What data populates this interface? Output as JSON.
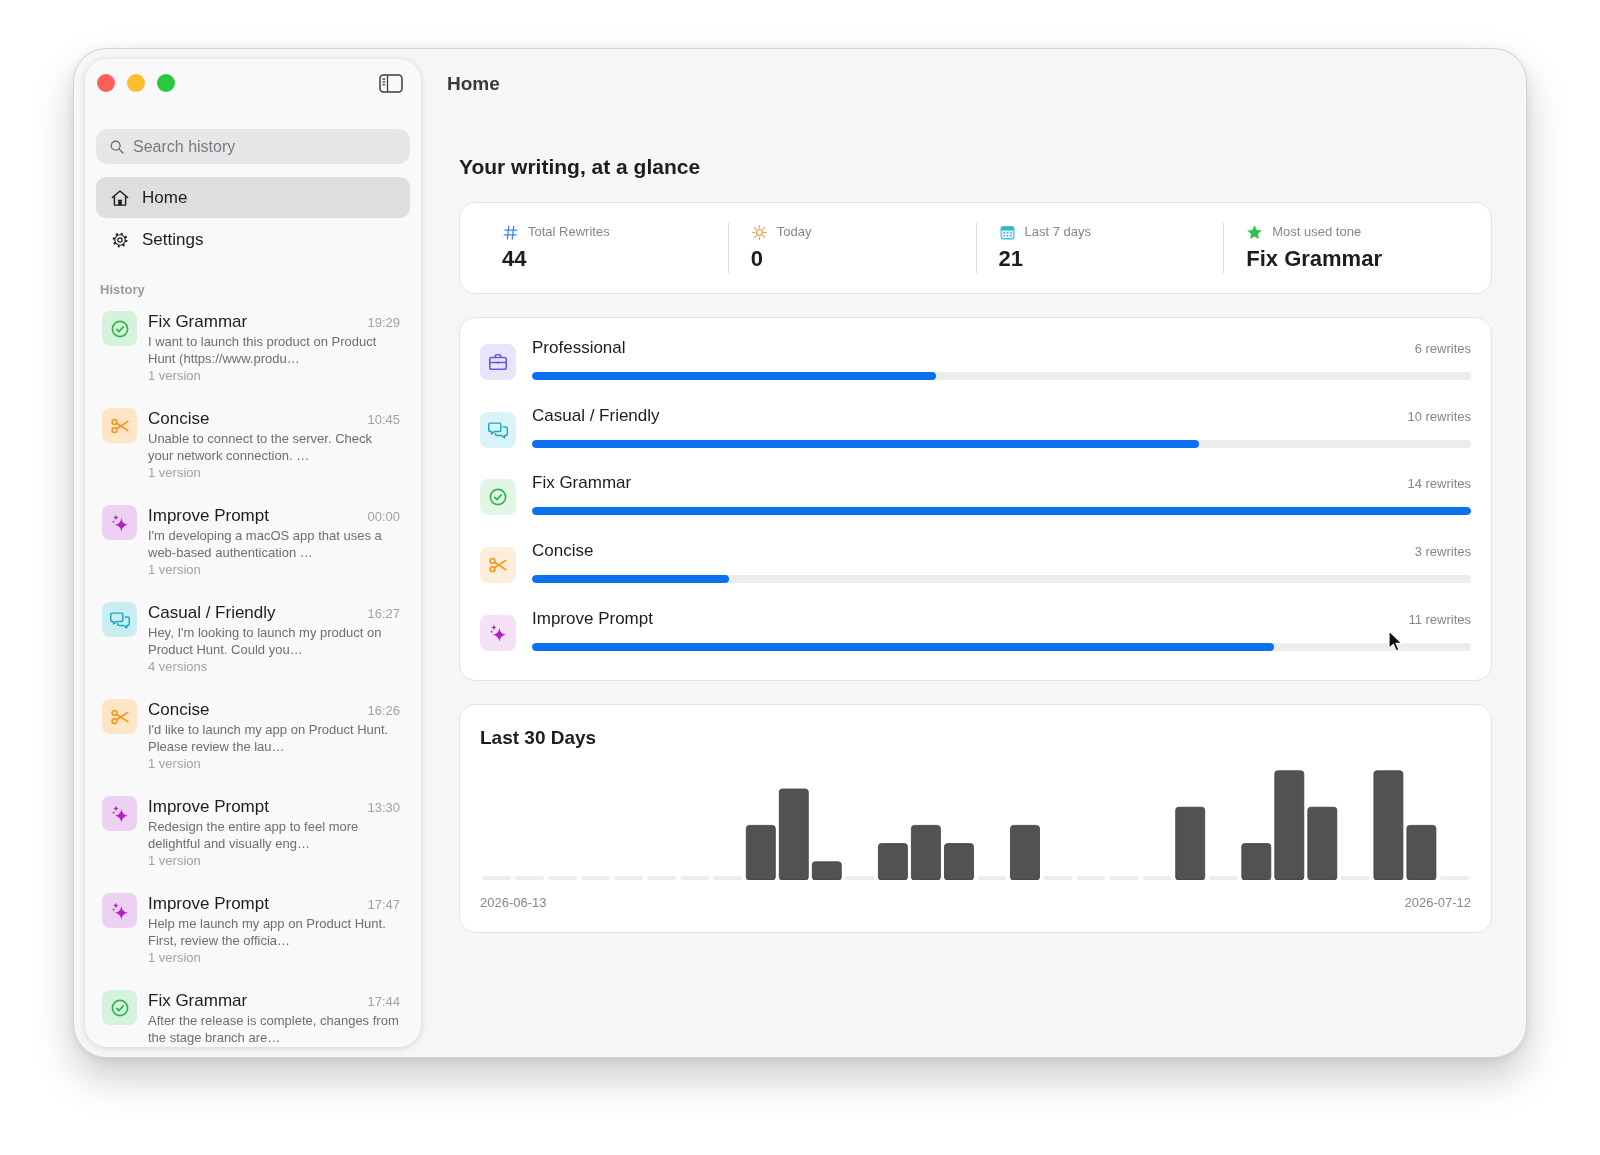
{
  "window": {
    "title": "Home"
  },
  "sidebar": {
    "search": {
      "placeholder": "Search history"
    },
    "nav": [
      {
        "kind": "home",
        "label": "Home",
        "selected": true
      },
      {
        "kind": "settings",
        "label": "Settings",
        "selected": false
      }
    ],
    "history_label": "History",
    "history": [
      {
        "kind": "grammar",
        "title": "Fix Grammar",
        "time": "19:29",
        "snippet": "I want to launch this product on Product Hunt (https://www.produ…",
        "versions": "1 version"
      },
      {
        "kind": "concise",
        "title": "Concise",
        "time": "10:45",
        "snippet": "Unable to connect to the server. Check your network connection. …",
        "versions": "1 version"
      },
      {
        "kind": "prompt",
        "title": "Improve Prompt",
        "time": "00:00",
        "snippet": "I'm developing a macOS app that uses a web-based authentication …",
        "versions": "1 version"
      },
      {
        "kind": "casual",
        "title": "Casual / Friendly",
        "time": "16:27",
        "snippet": "Hey, I'm looking to launch my product on Product Hunt. Could you…",
        "versions": "4 versions"
      },
      {
        "kind": "concise",
        "title": "Concise",
        "time": "16:26",
        "snippet": "I'd like to launch my app on Product Hunt. Please review the lau…",
        "versions": "1 version"
      },
      {
        "kind": "prompt",
        "title": "Improve Prompt",
        "time": "13:30",
        "snippet": "Redesign the entire app to feel more delightful and visually eng…",
        "versions": "1 version"
      },
      {
        "kind": "prompt",
        "title": "Improve Prompt",
        "time": "17:47",
        "snippet": "Help me launch my app on Product Hunt. First, review the officia…",
        "versions": "1 version"
      },
      {
        "kind": "grammar",
        "title": "Fix Grammar",
        "time": "17:44",
        "snippet": "After the release is complete, changes from the stage branch are…"
      }
    ]
  },
  "main": {
    "heading": "Your writing, at a glance",
    "stats": [
      {
        "kind": "hash",
        "label": "Total Rewrites",
        "value": "44"
      },
      {
        "kind": "sun",
        "label": "Today",
        "value": "0"
      },
      {
        "kind": "calendar",
        "label": "Last 7 days",
        "value": "21"
      },
      {
        "kind": "star",
        "label": "Most used tone",
        "value": "Fix Grammar"
      }
    ],
    "tones": [
      {
        "kind": "professional",
        "name": "Professional",
        "count": "6 rewrites",
        "level": 0.43
      },
      {
        "kind": "casual",
        "name": "Casual / Friendly",
        "count": "10 rewrites",
        "level": 0.71
      },
      {
        "kind": "grammar",
        "name": "Fix Grammar",
        "count": "14 rewrites",
        "level": 1
      },
      {
        "kind": "concise",
        "name": "Concise",
        "count": "3 rewrites",
        "level": 0.21
      },
      {
        "kind": "prompt",
        "name": "Improve Prompt",
        "count": "11 rewrites",
        "level": 0.79
      }
    ],
    "activity": {
      "title": "Last 30 Days",
      "start_date": "2026-06-13",
      "end_date": "2026-07-12"
    }
  }
}
